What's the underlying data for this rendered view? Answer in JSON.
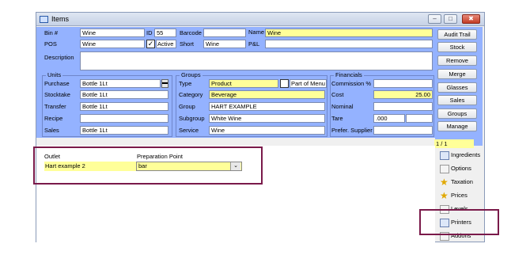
{
  "window": {
    "title": "Items"
  },
  "fields": {
    "bin_label": "Bin #",
    "bin_value": "Wine",
    "id_label": "ID",
    "id_value": "55",
    "barcode_label": "Barcode",
    "barcode_value": "",
    "name_label": "Name",
    "name_value": "Wine",
    "pos_label": "POS",
    "pos_value": "Wine",
    "active_label": "Active",
    "active_checked": true,
    "short_label": "Short",
    "short_value": "Wine",
    "pl_label": "P&L",
    "pl_value": "",
    "description_label": "Description",
    "description_value": ""
  },
  "units": {
    "title": "Units",
    "purchase_label": "Purchase",
    "purchase_value": "Bottle 1Lt",
    "stocktake_label": "Stocktake",
    "stocktake_value": "Bottle 1Lt",
    "transfer_label": "Transfer",
    "transfer_value": "Bottle 1Lt",
    "recipe_label": "Recipe",
    "recipe_value": "",
    "sales_label": "Sales",
    "sales_value": "Bottle 1Lt"
  },
  "groups": {
    "title": "Groups",
    "type_label": "Type",
    "type_value": "Product",
    "part_of_menu_label": "Part of Menu",
    "category_label": "Category",
    "category_value": "Beverage",
    "group_label": "Group",
    "group_value": "HART EXAMPLE",
    "subgroup_label": "Subgroup",
    "subgroup_value": "White Wine",
    "service_label": "Service",
    "service_value": "Wine"
  },
  "financials": {
    "title": "Financials",
    "commission_label": "Commission %",
    "commission_value": "",
    "cost_label": "Cost",
    "cost_value": "25.00",
    "nominal_label": "Nominal",
    "nominal_value": "",
    "tare_label": "Tare",
    "tare_value": ".000",
    "prefer_supplier_label": "Prefer. Supplier",
    "prefer_supplier_value": ""
  },
  "side_buttons": [
    "Audit Trail",
    "Stock",
    "Remove",
    "Merge",
    "Glasses",
    "Sales",
    "Groups",
    "Manage"
  ],
  "record_counter": "1 / 1",
  "outlet_grid": {
    "outlet_header": "Outlet",
    "prep_header": "Preparation Point",
    "outlet_value": "Hart example 2",
    "prep_value": "bar"
  },
  "tabs": [
    "Ingredients",
    "Options",
    "Taxation",
    "Prices",
    "Levels",
    "Printers",
    "Addons"
  ],
  "colors": {
    "panel": "#94b2ff",
    "highlight_field": "#ffff99",
    "annotation": "#7a1a4a"
  }
}
